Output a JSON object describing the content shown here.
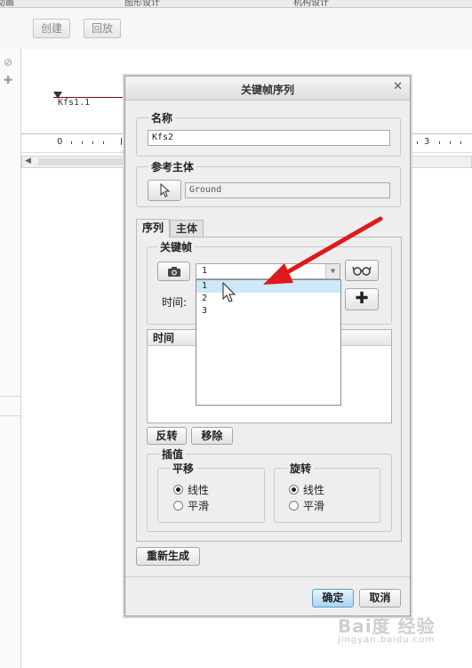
{
  "background": {
    "toolbar_buttons": [
      "创建",
      "回放"
    ],
    "top_strip_fragments": [
      "建动画",
      "图形设计",
      "机构设计"
    ],
    "track_label": "Kfs1.1",
    "ruler_labels": [
      "0",
      "3"
    ]
  },
  "dialog": {
    "title": "关键帧序列",
    "close_glyph": "✕",
    "name_group_title": "名称",
    "name_value": "Kfs2",
    "ref_body_group_title": "参考主体",
    "ref_body_value": "Ground",
    "tabs": [
      {
        "label": "序列",
        "active": true
      },
      {
        "label": "主体",
        "active": false
      }
    ],
    "keyframe_group_title": "关键帧",
    "keyframe_selected": "1",
    "keyframe_options": [
      "1",
      "2",
      "3"
    ],
    "time_label": "时间:",
    "list_header": "时间",
    "reverse_button": "反转",
    "remove_button": "移除",
    "interp_group_title": "插值",
    "translate_title": "平移",
    "rotate_title": "旋转",
    "translate_options": [
      {
        "label": "线性",
        "checked": true
      },
      {
        "label": "平滑",
        "checked": false
      }
    ],
    "rotate_options": [
      {
        "label": "线性",
        "checked": true
      },
      {
        "label": "平滑",
        "checked": false
      }
    ],
    "regenerate_button": "重新生成",
    "ok_button": "确定",
    "cancel_button": "取消"
  },
  "icons": [
    "camera-icon",
    "glasses-icon",
    "plus-icon",
    "select-arrow-icon",
    "close-icon",
    "chevron-down-icon",
    "mouse-cursor-icon",
    "red-arrow-annotation"
  ],
  "watermark": {
    "text": "Bai度 经验",
    "subtext": "jingyan.baidu.com"
  },
  "colors": {
    "dialog_bg": "#eeeeee",
    "selected_option": "#cde8f8",
    "ok_button": "#a9d6f2",
    "annotation_arrow": "#e0191b"
  }
}
